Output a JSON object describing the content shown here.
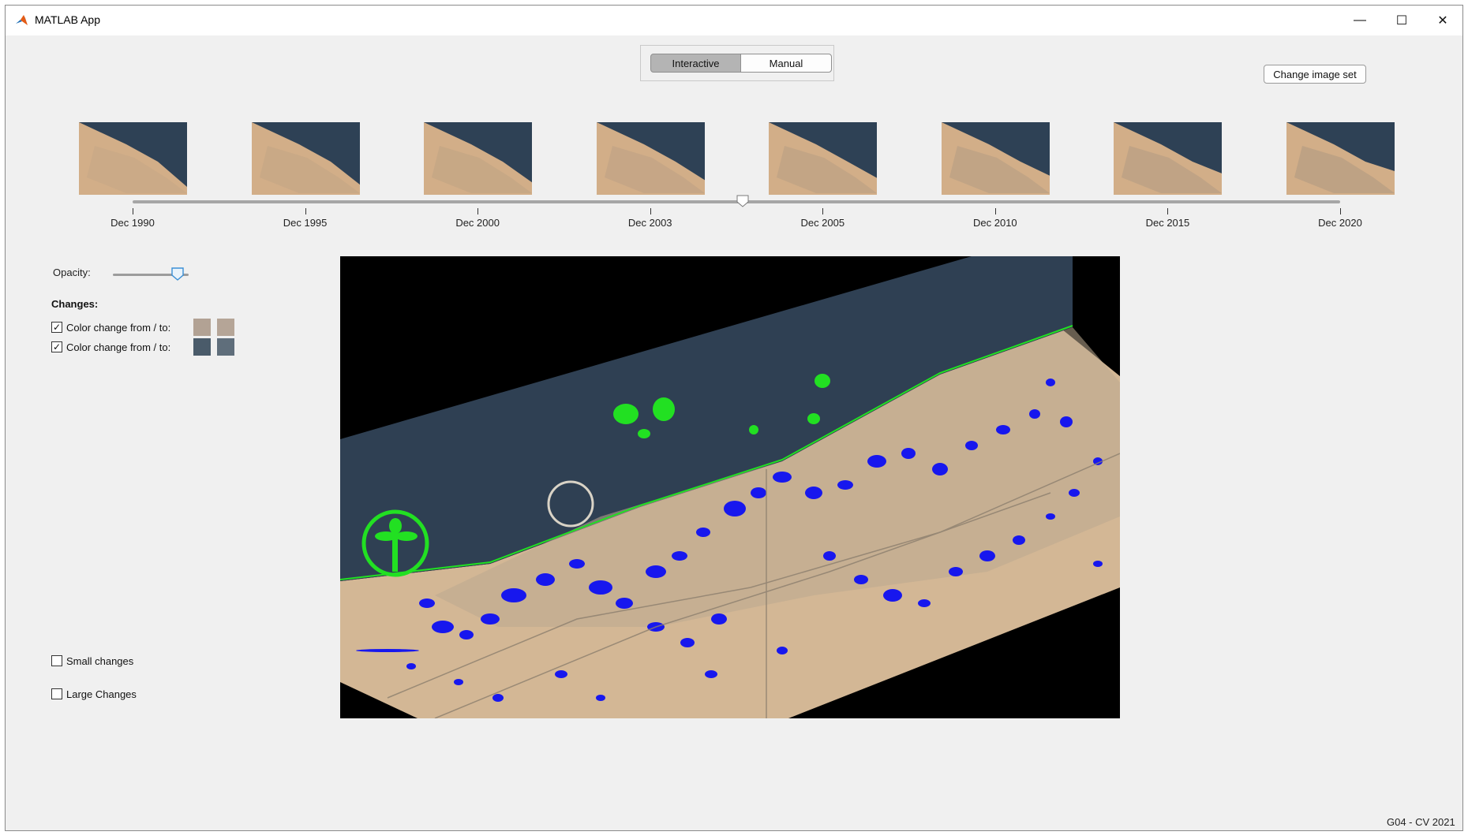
{
  "window": {
    "title": "MATLAB App",
    "controls": {
      "minimize": "—",
      "maximize": "☐",
      "close": "✕"
    }
  },
  "mode_toggle": {
    "options": [
      "Interactive",
      "Manual"
    ],
    "selected": "Interactive"
  },
  "change_image_set_label": "Change image set",
  "timeline": {
    "dates": [
      "Dec 1990",
      "Dec 1995",
      "Dec 2000",
      "Dec 2003",
      "Dec 2005",
      "Dec 2010",
      "Dec 2015",
      "Dec 2020"
    ],
    "slider_position_fraction": 0.505
  },
  "opacity": {
    "label": "Opacity:",
    "value_fraction": 0.85
  },
  "changes": {
    "heading": "Changes:",
    "rows": [
      {
        "label": "Color change from / to:",
        "checked": true,
        "from_color": "#b2a294",
        "to_color": "#b5a597"
      },
      {
        "label": "Color change from / to:",
        "checked": true,
        "from_color": "#4a5b6a",
        "to_color": "#5f6e7b"
      }
    ]
  },
  "options": [
    {
      "label": "Small changes",
      "checked": false
    },
    {
      "label": "Large Changes",
      "checked": false
    }
  ],
  "footer": "G04 - CV 2021",
  "colors": {
    "sea": "#2e3f52",
    "land": "#d4b898",
    "change_growth": "#1ee21e",
    "change_urban": "#1818ee",
    "background": "#f0f0f0"
  },
  "icons": {
    "app": "matlab-logo-icon",
    "checkmark": "✓"
  }
}
